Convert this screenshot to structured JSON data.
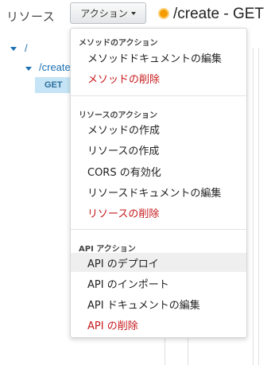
{
  "header": {
    "resources_title": "リソース",
    "actions_button_label": "アクション",
    "path_title": "/create - GET"
  },
  "tree": {
    "root_label": "/",
    "child_label": "/create",
    "method_badge": "GET"
  },
  "dropdown": {
    "method_section": {
      "header": "メソッドのアクション",
      "items": [
        {
          "label": "メソッドドキュメントの編集",
          "danger": false
        },
        {
          "label": "メソッドの削除",
          "danger": true
        }
      ]
    },
    "resource_section": {
      "header": "リソースのアクション",
      "items": [
        {
          "label": "メソッドの作成",
          "danger": false
        },
        {
          "label": "リソースの作成",
          "danger": false
        },
        {
          "label": "CORS の有効化",
          "danger": false
        },
        {
          "label": "リソースドキュメントの編集",
          "danger": false
        },
        {
          "label": "リソースの削除",
          "danger": true
        }
      ]
    },
    "api_section": {
      "header": "API アクション",
      "items": [
        {
          "label": "API のデプロイ",
          "danger": false
        },
        {
          "label": "API のインポート",
          "danger": false
        },
        {
          "label": "API ドキュメントの編集",
          "danger": false
        },
        {
          "label": "API の削除",
          "danger": true
        }
      ]
    }
  },
  "colors": {
    "danger": "#c7191b",
    "link": "#1a6fb3",
    "badge_bg": "#c5e4f5",
    "method_dot": "#f59b00",
    "hover_bg": "#efefef"
  },
  "icons": {
    "actions_caret": "caret-down-icon",
    "tree_expand": "caret-down-icon",
    "method_status": "status-dot-icon"
  }
}
